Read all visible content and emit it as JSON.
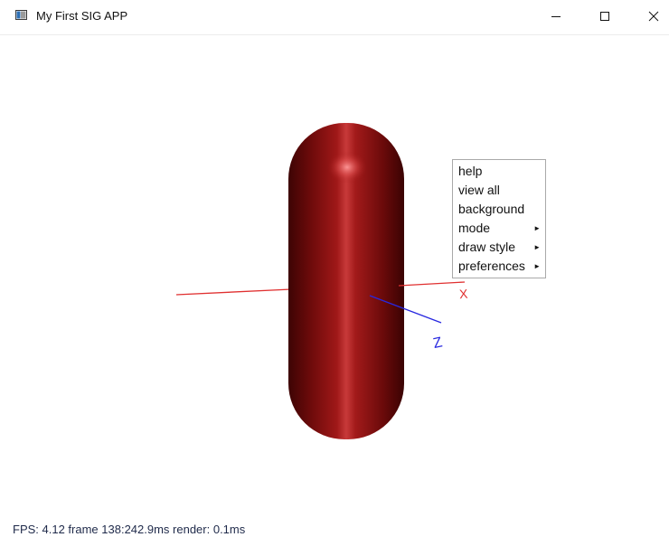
{
  "window": {
    "title": "My First SIG APP",
    "controls": [
      "minimize-icon",
      "maximize-icon",
      "close-icon"
    ]
  },
  "scene": {
    "object": "capsule",
    "object_color": "#8b0f0f",
    "axes": {
      "x_label": "X",
      "z_label": "Z",
      "x_color": "#e03030",
      "z_color": "#2828e0"
    }
  },
  "context_menu": {
    "items": [
      {
        "label": "help",
        "submenu": false
      },
      {
        "label": "view all",
        "submenu": false
      },
      {
        "label": "background",
        "submenu": false
      },
      {
        "label": "mode",
        "submenu": true
      },
      {
        "label": "draw style",
        "submenu": true
      },
      {
        "label": "preferences",
        "submenu": true
      }
    ],
    "submenu_glyph": "►"
  },
  "status": {
    "fps_text": "FPS: 4.12 frame 138:242.9ms render: 0.1ms"
  }
}
